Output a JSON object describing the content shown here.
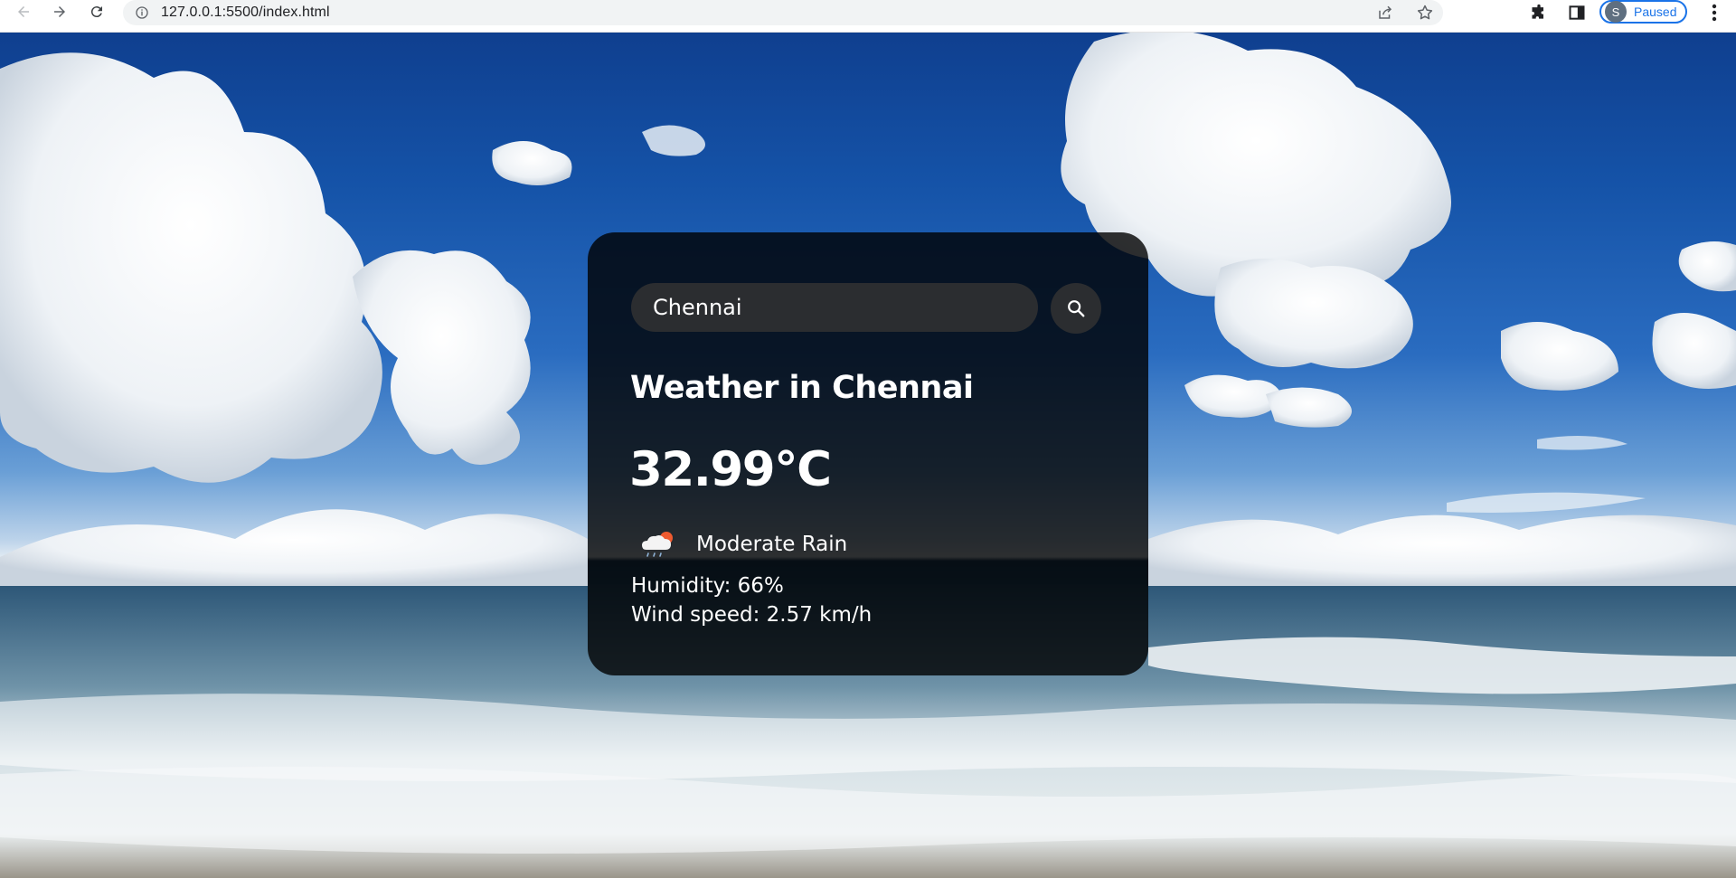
{
  "browser": {
    "url": "127.0.0.1:5500/index.html",
    "profile_initial": "S",
    "profile_status": "Paused",
    "accent": "#1a73e8",
    "icons": [
      "back-arrow-icon",
      "forward-arrow-icon",
      "reload-icon",
      "info-icon",
      "share-icon",
      "star-icon",
      "puzzle-icon",
      "side-panel-icon",
      "more-vert-icon"
    ]
  },
  "weather": {
    "search_value": "Chennai",
    "heading": "Weather in Chennai",
    "temperature": "32.99°C",
    "condition": "Moderate Rain",
    "condition_icon": "cloud-rain-icon",
    "humidity": "Humidity: 66%",
    "wind": "Wind speed: 2.57 km/h"
  }
}
